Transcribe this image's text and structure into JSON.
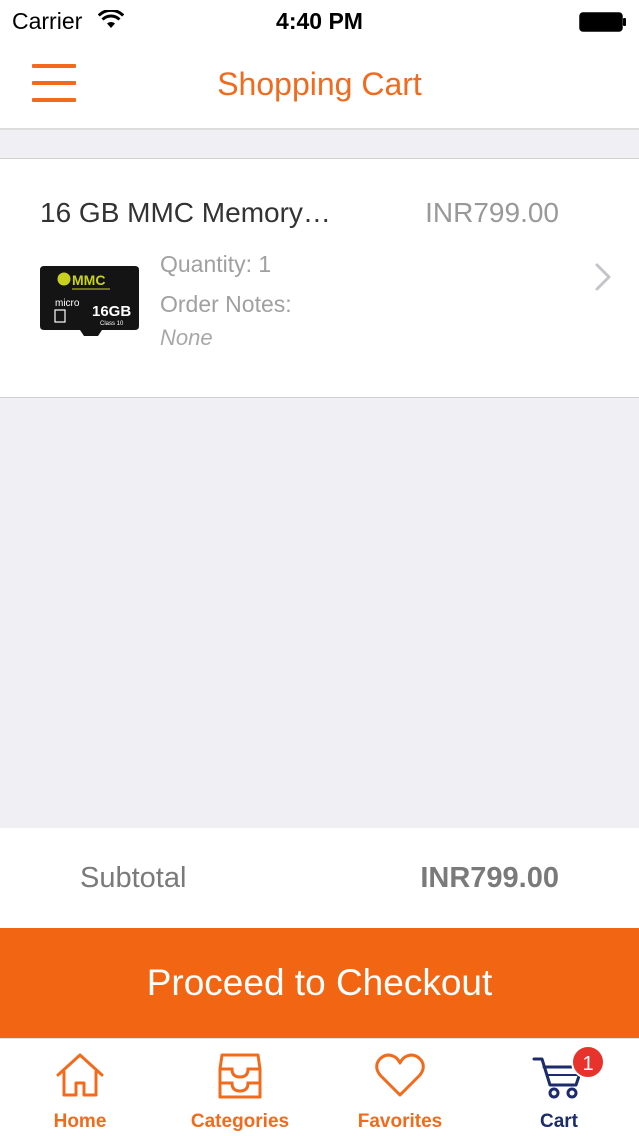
{
  "status_bar": {
    "carrier": "Carrier",
    "time": "4:40 PM"
  },
  "nav": {
    "title": "Shopping Cart"
  },
  "cart": {
    "items": [
      {
        "name": "16 GB MMC Memory…",
        "price": "INR799.00",
        "quantity_text": "Quantity: 1",
        "notes_label": "Order Notes:",
        "notes_value": "None",
        "thumb": {
          "brand": "MMC",
          "capacity": "16GB",
          "class": "Class 10",
          "type": "micro"
        }
      }
    ]
  },
  "summary": {
    "subtotal_label": "Subtotal",
    "subtotal_value": "INR799.00"
  },
  "checkout": {
    "label": "Proceed to Checkout"
  },
  "tabs": [
    {
      "label": "Home",
      "icon": "home-icon"
    },
    {
      "label": "Categories",
      "icon": "categories-icon"
    },
    {
      "label": "Favorites",
      "icon": "heart-icon"
    },
    {
      "label": "Cart",
      "icon": "cart-icon",
      "badge": "1"
    }
  ],
  "colors": {
    "accent": "#f26b1d",
    "checkout": "#f26613",
    "active_tab": "#1b2b6b",
    "badge": "#e8322c"
  }
}
